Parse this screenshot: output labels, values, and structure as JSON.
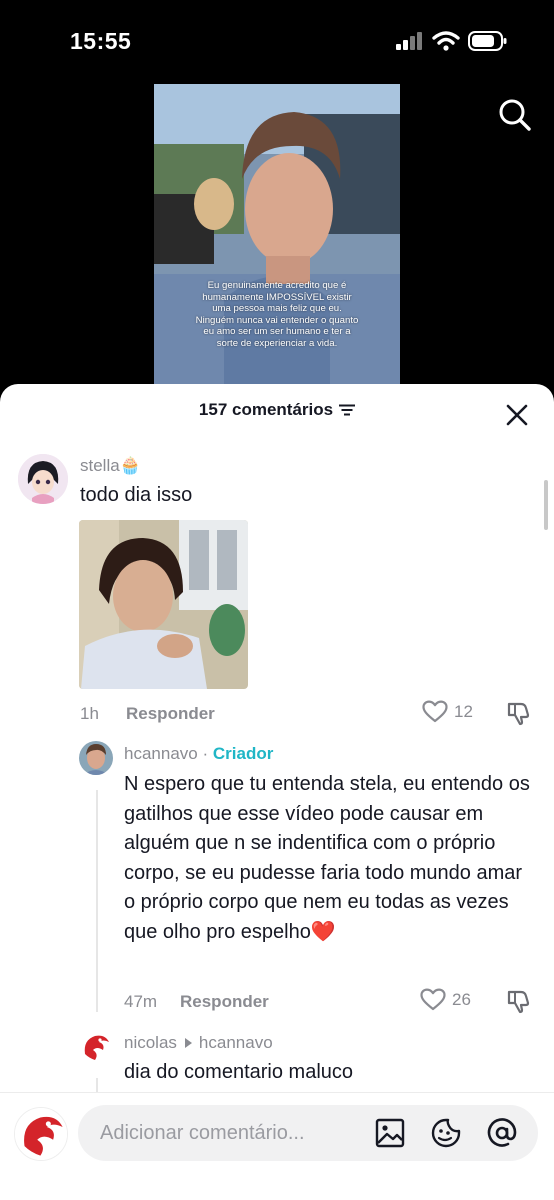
{
  "status_bar": {
    "time": "15:55"
  },
  "video": {
    "caption": "Eu genuinamente acredito que é humanamente IMPOSSÍVEL existir uma pessoa mais feliz que eu. Ninguém nunca vai entender o quanto eu amo ser um ser humano e ter a sorte de experienciar a vida."
  },
  "comments_sheet": {
    "count_label": "157 comentários",
    "comments": [
      {
        "username": "stella🧁",
        "text": "todo dia isso",
        "time": "1h",
        "reply_label": "Responder",
        "likes": "12"
      }
    ],
    "replies": [
      {
        "username": "hcannavo",
        "separator": "·",
        "badge": "Criador",
        "text": "N espero que tu entenda stela, eu entendo os gatilhos que esse vídeo pode causar em alguém que n se indentifica com o próprio corpo, se eu pudesse faria todo mundo amar o próprio corpo que nem eu todas as vezes que olho pro espelho❤️",
        "time": "47m",
        "reply_label": "Responder",
        "likes": "26"
      },
      {
        "username": "nicolas",
        "reply_to": "hcannavo",
        "text": "dia do comentario maluco"
      }
    ]
  },
  "composer": {
    "placeholder": "Adicionar comentário..."
  },
  "colors": {
    "accent": "#20b6c6",
    "sheet_bg": "#ffffff",
    "muted": "#8a8b91",
    "text": "#161823"
  }
}
